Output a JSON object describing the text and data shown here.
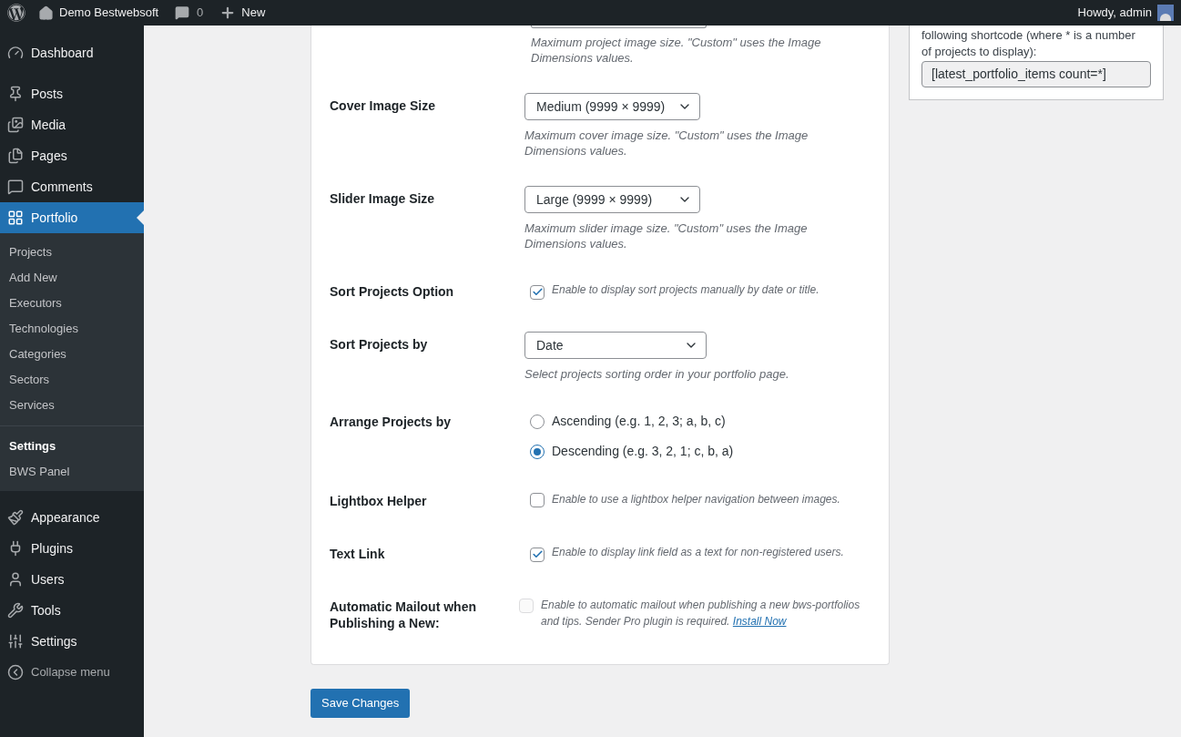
{
  "admin_bar": {
    "site_name": "Demo Bestwebsoft",
    "comments_count": "0",
    "new_label": "New",
    "greeting": "Howdy, admin"
  },
  "sidebar": {
    "top_items": [
      {
        "label": "Dashboard",
        "selected": false
      },
      {
        "label": "Posts",
        "selected": false
      },
      {
        "label": "Media",
        "selected": false
      },
      {
        "label": "Pages",
        "selected": false
      },
      {
        "label": "Comments",
        "selected": false
      },
      {
        "label": "Portfolio",
        "selected": true
      }
    ],
    "submenu_groups": [
      [
        {
          "label": "Projects",
          "selected": false
        },
        {
          "label": "Add New",
          "selected": false
        },
        {
          "label": "Executors",
          "selected": false
        },
        {
          "label": "Technologies",
          "selected": false
        },
        {
          "label": "Categories",
          "selected": false
        },
        {
          "label": "Sectors",
          "selected": false
        },
        {
          "label": "Services",
          "selected": false
        }
      ],
      [
        {
          "label": "Settings",
          "selected": true
        },
        {
          "label": "BWS Panel",
          "selected": false
        }
      ]
    ],
    "bottom_items": [
      {
        "label": "Appearance",
        "selected": false
      },
      {
        "label": "Plugins",
        "selected": false
      },
      {
        "label": "Users",
        "selected": false
      },
      {
        "label": "Tools",
        "selected": false
      },
      {
        "label": "Settings",
        "selected": false
      }
    ],
    "collapse_label": "Collapse menu"
  },
  "partial_row": {
    "description": "Maximum project image size. \"Custom\" uses the Image Dimensions values."
  },
  "rows": [
    {
      "label": "Cover Image Size",
      "kind": "select",
      "value": "Medium (9999 × 9999)",
      "description": "Maximum cover image size. \"Custom\" uses the Image Dimensions values."
    },
    {
      "label": "Slider Image Size",
      "kind": "select",
      "value": "Large (9999 × 9999)",
      "description": "Maximum slider image size. \"Custom\" uses the Image Dimensions values."
    },
    {
      "label": "Sort Projects Option",
      "kind": "checkbox",
      "checked": true,
      "disabled": false,
      "description": "Enable to display sort projects manually by date or title."
    },
    {
      "label": "Sort Projects by",
      "kind": "select",
      "value": "Date",
      "description": "Select projects sorting order in your portfolio page."
    },
    {
      "label": "Arrange Projects by",
      "kind": "radio",
      "options": [
        {
          "label": "Ascending (e.g. 1, 2, 3; a, b, c)",
          "selected": false
        },
        {
          "label": "Descending (e.g. 3, 2, 1; c, b, a)",
          "selected": true
        }
      ]
    },
    {
      "label": "Lightbox Helper",
      "kind": "checkbox",
      "checked": false,
      "disabled": false,
      "description": "Enable to use a lightbox helper navigation between images."
    },
    {
      "label": "Text Link",
      "kind": "checkbox",
      "checked": true,
      "disabled": false,
      "description": "Enable to display link field as a text for non-registered users."
    },
    {
      "label": "Automatic Mailout when Publishing a New:",
      "kind": "checkbox",
      "checked": false,
      "disabled": true,
      "description": "Enable to automatic mailout when publishing a new bws-portfolios and tips. Sender Pro plugin is required.",
      "link": "Install Now"
    }
  ],
  "side_card": {
    "lines": [
      "following shortcode (where * is a number",
      "of projects to display):"
    ],
    "shortcode": "[latest_portfolio_items count=*]"
  },
  "save_button": "Save Changes"
}
